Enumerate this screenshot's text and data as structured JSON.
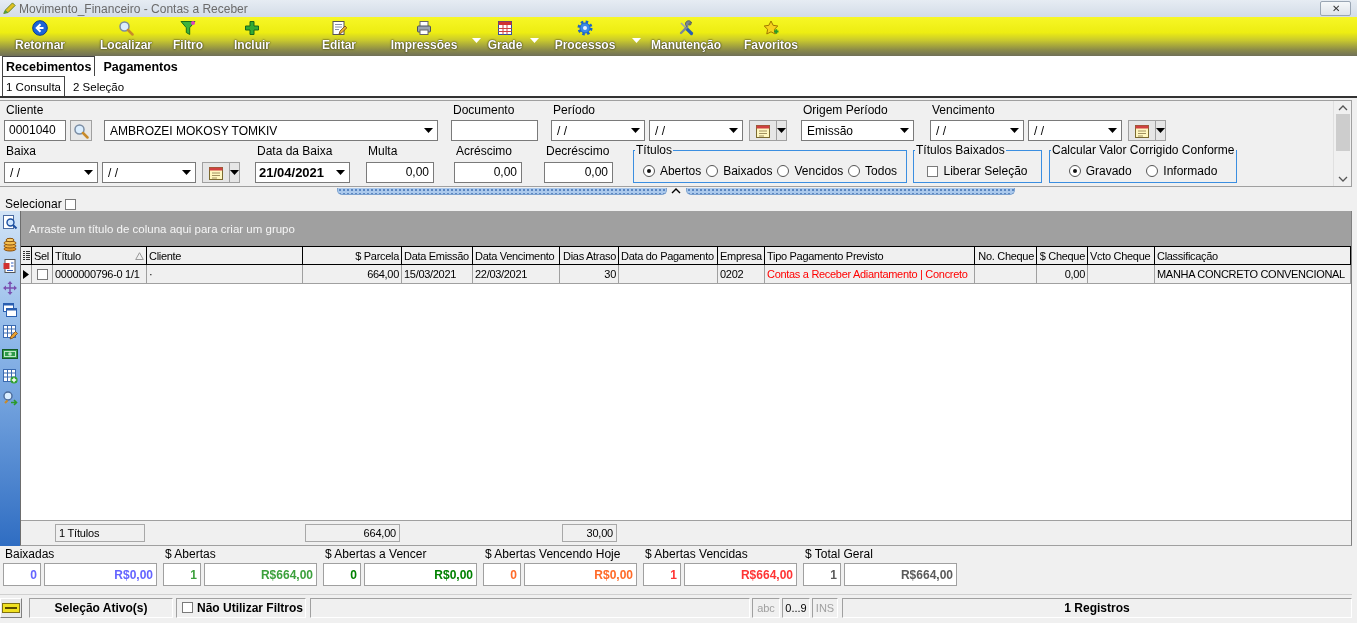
{
  "window": {
    "title": "Movimento_Financeiro - Contas a Receber",
    "close": "✕"
  },
  "toolbar": [
    {
      "label": "Retornar",
      "dropdown": false
    },
    {
      "label": "Localizar",
      "dropdown": false
    },
    {
      "label": "Filtro",
      "dropdown": false
    },
    {
      "label": "Incluir",
      "dropdown": false
    },
    {
      "label": "Editar",
      "dropdown": false
    },
    {
      "label": "Impressões",
      "dropdown": true
    },
    {
      "label": "Grade",
      "dropdown": true
    },
    {
      "label": "Processos",
      "dropdown": true
    },
    {
      "label": "Manutenção",
      "dropdown": false
    },
    {
      "label": "Favoritos",
      "dropdown": false
    }
  ],
  "tabs": [
    {
      "label": "Recebimentos",
      "selected": true
    },
    {
      "label": "Pagamentos",
      "selected": false
    }
  ],
  "subtabs": [
    {
      "label": "1 Consulta",
      "selected": true
    },
    {
      "label": "2 Seleção",
      "selected": false
    }
  ],
  "filters": {
    "cliente": {
      "label": "Cliente",
      "code": "0001040",
      "name": "AMBROZEI MOKOSY TOMKIV"
    },
    "documento": {
      "label": "Documento"
    },
    "periodo": {
      "label": "Período",
      "from": "/ /",
      "to": "/ /"
    },
    "origem_periodo": {
      "label": "Origem Período",
      "value": "Emissão"
    },
    "vencimento": {
      "label": "Vencimento",
      "from": "/ /",
      "to": "/ /"
    },
    "baixa": {
      "label": "Baixa",
      "from": "/ /",
      "to": "/ /"
    },
    "data_da_baixa": {
      "label": "Data da Baixa",
      "value": "21/04/2021"
    },
    "multa": {
      "label": "Multa",
      "value": "0,00"
    },
    "acrescimo": {
      "label": "Acréscimo",
      "value": "0,00"
    },
    "decrescimo": {
      "label": "Decréscimo",
      "value": "0,00"
    },
    "titulos": {
      "label": "Títulos",
      "kind": "radio",
      "options": [
        {
          "label": "Abertos",
          "selected": true
        },
        {
          "label": "Baixados",
          "selected": false
        },
        {
          "label": "Vencidos",
          "selected": false
        },
        {
          "label": "Todos",
          "selected": false
        }
      ]
    },
    "titulos_baixados": {
      "label": "Títulos Baixados",
      "kind": "checkbox",
      "options": [
        {
          "label": "Liberar Seleção",
          "checked": false
        }
      ]
    },
    "calcular_valor_corrigido": {
      "label": "Calcular Valor Corrigido Conforme",
      "kind": "radio",
      "options": [
        {
          "label": "Gravado",
          "selected": true
        },
        {
          "label": "Informado",
          "selected": false
        }
      ]
    }
  },
  "selecionar": {
    "label": "Selecionar",
    "checked": false
  },
  "grid": {
    "group_hint": "Arraste um título de coluna aqui para criar um grupo",
    "columns": [
      {
        "label": "Sel",
        "kind": "check",
        "sorted": false
      },
      {
        "label": "Título",
        "kind": "text",
        "sorted": true
      },
      {
        "label": "Cliente",
        "kind": "text",
        "sorted": false
      },
      {
        "label": "$ Parcela",
        "kind": "number",
        "sorted": false
      },
      {
        "label": "Data Emissão",
        "kind": "text",
        "sorted": false
      },
      {
        "label": "Data Vencimento",
        "kind": "text",
        "sorted": false
      },
      {
        "label": "Dias Atraso",
        "kind": "number",
        "sorted": false
      },
      {
        "label": "Data do Pagamento",
        "kind": "text",
        "sorted": false
      },
      {
        "label": "Empresa",
        "kind": "text",
        "sorted": false
      },
      {
        "label": "Tipo Pagamento Previsto",
        "kind": "text",
        "sorted": false
      },
      {
        "label": "No. Cheque",
        "kind": "number",
        "sorted": false
      },
      {
        "label": "$ Cheque",
        "kind": "number",
        "sorted": false
      },
      {
        "label": "Vcto Cheque",
        "kind": "text",
        "sorted": false
      },
      {
        "label": "Classificação",
        "kind": "text",
        "sorted": false
      }
    ],
    "rows": [
      {
        "selected": true,
        "checked": false,
        "titulo": {
          "text": "0000000796-0 1/1"
        },
        "cliente": {
          "text": "·"
        },
        "parcela": {
          "text": "664,00"
        },
        "data_emissao": {
          "text": "15/03/2021"
        },
        "data_vencimento": {
          "text": "22/03/2021"
        },
        "dias_atraso": {
          "text": "30"
        },
        "empresa": {
          "text": "0202"
        },
        "tipo_pagamento_previsto": {
          "text": "Contas a Receber Adiantamento | Concreto",
          "color": "#ff0000"
        },
        "valor_cheque": {
          "text": "0,00"
        },
        "classificacao": {
          "text": "MANHA CONCRETO CONVENCIONAL"
        }
      }
    ],
    "footer": {
      "titulo": "1 Títulos",
      "parcela": "664,00",
      "dias_atraso": "30,00"
    }
  },
  "totals": [
    {
      "label": "Baixadas",
      "count": "0",
      "value": "R$0,00",
      "color": "#6464ff"
    },
    {
      "label": "$ Abertas",
      "count": "1",
      "value": "R$664,00",
      "color": "#3ca03c"
    },
    {
      "label": "$ Abertas a Vencer",
      "count": "0",
      "value": "R$0,00",
      "color": "#008000"
    },
    {
      "label": "$ Abertas Vencendo Hoje",
      "count": "0",
      "value": "R$0,00",
      "color": "#ff6a28"
    },
    {
      "label": "$ Abertas Vencidas",
      "count": "1",
      "value": "R$664,00",
      "color": "#ff3434"
    },
    {
      "label": "$ Total Geral",
      "count": "1",
      "value": "R$664,00",
      "color": "#5a5a5a"
    }
  ],
  "status_bar": {
    "selection": "Seleção Ativo(s)",
    "filter_option": {
      "label": "Não Utilizar Filtros",
      "checked": false
    },
    "indicators": [
      {
        "label": "abc",
        "on": false
      },
      {
        "label": "0...9",
        "on": true
      },
      {
        "label": "INS",
        "on": false
      }
    ],
    "records": "1 Registros"
  }
}
